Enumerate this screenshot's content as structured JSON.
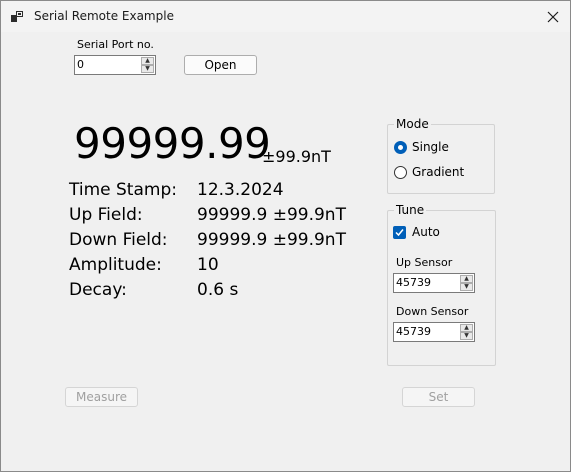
{
  "window": {
    "title": "Serial Remote Example"
  },
  "serial": {
    "label": "Serial Port no.",
    "value": "0",
    "open_label": "Open"
  },
  "reading": {
    "value": "99999.99",
    "uncertainty": "±99.9nT"
  },
  "info": [
    {
      "label": "Time Stamp:",
      "value": "12.3.2024"
    },
    {
      "label": "Up Field:",
      "value": "99999.9 ±99.9nT"
    },
    {
      "label": "Down Field:",
      "value": "99999.9 ±99.9nT"
    },
    {
      "label": "Amplitude:",
      "value": "10"
    },
    {
      "label": "Decay:",
      "value": "0.6 s"
    }
  ],
  "mode": {
    "title": "Mode",
    "options": [
      "Single",
      "Gradient"
    ],
    "selected": "Single"
  },
  "tune": {
    "title": "Tune",
    "auto_label": "Auto",
    "auto_checked": true,
    "up_label": "Up Sensor",
    "up_value": "45739",
    "down_label": "Down Sensor",
    "down_value": "45739"
  },
  "buttons": {
    "measure": "Measure",
    "set": "Set"
  },
  "colors": {
    "accent": "#005fb8",
    "disabled_text": "#a0a0a0"
  }
}
